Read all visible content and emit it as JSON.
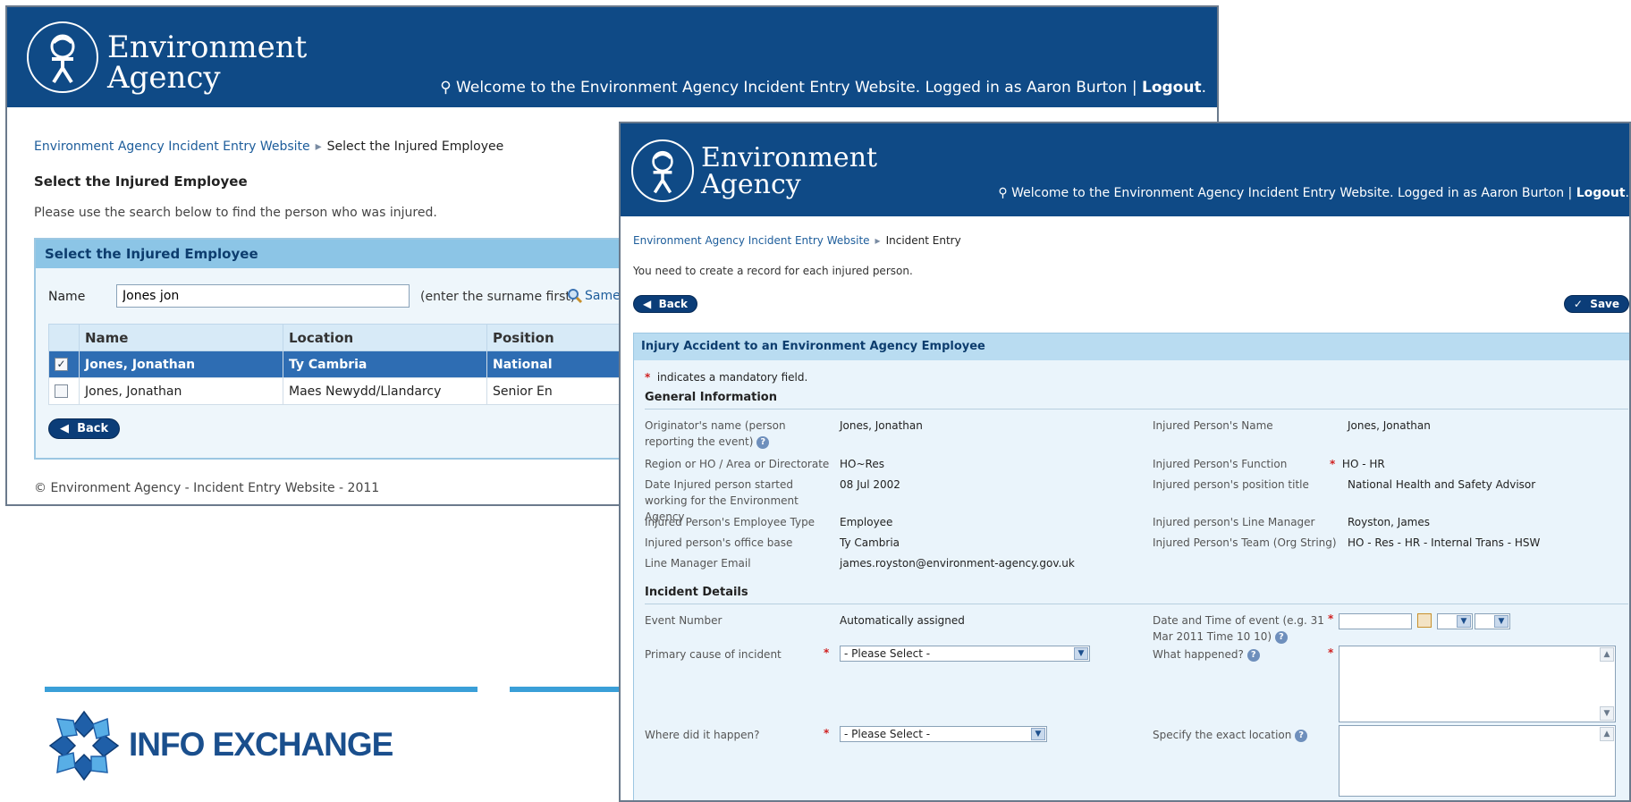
{
  "brand": {
    "line1": "Environment",
    "line2": "Agency"
  },
  "header": {
    "welcome_text": "Welcome to the Environment Agency Incident Entry Website. Logged in as Aaron Burton | ",
    "logout_label": "Logout",
    "logout_suffix": ".",
    "header_color": "#0f4a86"
  },
  "window1": {
    "breadcrumb": {
      "home": "Environment Agency Incident Entry Website",
      "current": "Select the Injured Employee"
    },
    "page_title": "Select the Injured Employee",
    "instructions": "Please use the search below to find the person who was injured.",
    "panel_title": "Select the Injured Employee",
    "search": {
      "label": "Name",
      "value": "Jones jon",
      "hint": "(enter the surname first)",
      "same_link": "Same a"
    },
    "table": {
      "columns": [
        "Name",
        "Location",
        "Position"
      ],
      "rows": [
        {
          "checked": true,
          "selected": true,
          "name": "Jones, Jonathan",
          "location": "Ty Cambria",
          "position": "National"
        },
        {
          "checked": false,
          "selected": false,
          "name": "Jones, Jonathan",
          "location": "Maes Newydd/Llandarcy",
          "position": "Senior En"
        }
      ]
    },
    "back_label": "Back",
    "footer": "© Environment Agency - Incident Entry Website - 2011"
  },
  "branding": {
    "info_exchange": "INFO EXCHANGE",
    "accent_color": "#3a9fd8"
  },
  "window2": {
    "breadcrumb": {
      "home": "Environment Agency Incident Entry Website",
      "current": "Incident Entry"
    },
    "note": "You need to create a record for each injured person.",
    "back_label": "Back",
    "save_label": "Save",
    "panel_title": "Injury Accident to an Environment Agency Employee",
    "mandatory_note": "indicates a mandatory field.",
    "general_section": "General Information",
    "left_fields": {
      "originator_label": "Originator's name (person reporting the event)",
      "originator_value": "Jones, Jonathan",
      "region_label": "Region or HO / Area or Directorate",
      "region_value": "HO~Res",
      "date_started_label": "Date Injured person started working for the Environment Agency",
      "date_started_value": "08 Jul 2002",
      "employee_type_label": "Injured Person's Employee Type",
      "employee_type_value": "Employee",
      "office_base_label": "Injured person's office base",
      "office_base_value": "Ty Cambria",
      "manager_email_label": "Line Manager Email",
      "manager_email_value": "james.royston@environment-agency.gov.uk"
    },
    "right_fields": {
      "injured_name_label": "Injured Person's Name",
      "injured_name_value": "Jones, Jonathan",
      "function_label": "Injured Person's Function",
      "function_value": "HO - HR",
      "position_label": "Injured person's position title",
      "position_value": "National Health and Safety Advisor",
      "line_manager_label": "Injured person's Line Manager",
      "line_manager_value": "Royston, James",
      "team_label": "Injured Person's Team (Org String)",
      "team_value": "HO - Res - HR - Internal Trans - HSW"
    },
    "incident_section": "Incident Details",
    "incident": {
      "event_number_label": "Event Number",
      "event_number_value": "Automatically assigned",
      "datetime_label": "Date and Time of event (e.g. 31 Mar 2011 Time 10 10)",
      "primary_cause_label": "Primary cause of incident",
      "primary_cause_value": "- Please Select -",
      "what_happened_label": "What happened?",
      "where_label": "Where did it happen?",
      "where_value": "- Please Select -",
      "exact_location_label": "Specify the exact location"
    }
  }
}
